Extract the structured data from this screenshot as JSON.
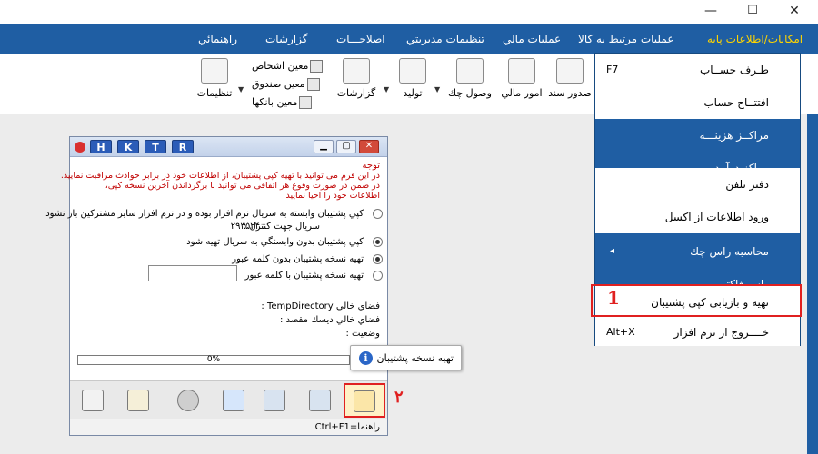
{
  "window": {
    "minimize": "—",
    "maximize": "☐",
    "close": "✕"
  },
  "menu": {
    "items": [
      "امکانات/اطلاعات پایه",
      "عملیات مرتبط به کالا",
      "عملیات مالي",
      "تنظیمات مدیریتي",
      "اصلاحـــات",
      "گزارشات",
      "راهنمائي"
    ]
  },
  "toolbar": {
    "buttons": [
      "صدور سند",
      "امور مالي",
      "وصول چك",
      "تولید",
      "گزارشات",
      "تنظیمات"
    ],
    "small_items": [
      "معین اشخاص",
      "معین صندوق",
      "معین بانکها"
    ]
  },
  "dropdown": {
    "items": [
      {
        "label": "طـرف حســاب",
        "shortcut": "F7"
      },
      {
        "label": "افتتــاح حساب",
        "shortcut": ""
      },
      {
        "label": "مراکــز هزینـــه",
        "shortcut": ""
      },
      {
        "label": "مراکز درآمد",
        "shortcut": ""
      },
      {
        "label": "دفتر تلفن",
        "shortcut": ""
      },
      {
        "label": "ورود اطلاعات از اکسل",
        "shortcut": ""
      },
      {
        "label": "محاسبه راس چك",
        "shortcut": "◂"
      },
      {
        "label": "راس فاکتــور",
        "shortcut": ""
      },
      {
        "label": "تهیه و بازیابی کپی پشتیبان",
        "shortcut": ""
      },
      {
        "label": "خــــروج از نرم افزار",
        "shortcut": "Alt+X"
      }
    ],
    "step_number": "1"
  },
  "dialog": {
    "hktr": [
      "H",
      "K",
      "T",
      "R"
    ],
    "warning_title": "توجه",
    "warning_lines": [
      "در این فرم می توانید با تهیه کپی پشتیبان، از اطلاعات خود در برابر حوادث مراقبت نمایید.",
      "در ضمن در صورت وقوع هر اتفاقی می توانید با برگرداندن آخرین نسخه کپی،",
      "اطلاعات خود را احیا نمایید"
    ],
    "option_serial": "کپي پشتیبان وابسته به سریال نرم افزار بوده و در نرم افزار سایر مشترکین باز نشود",
    "serial_label": "سریال جهت کنترل :",
    "serial_value": "۲۹۳۵۲۴",
    "option_no_serial": "کپي پشتیبان بدون وابستگي به سریال تهیه شود",
    "option_no_password": "تهیه نسخه پشتیبان بدون کلمه عبور",
    "option_password": "تهیه نسخه پشتیبان با کلمه عبور",
    "free_temp": "فضاي خالي TempDirectory :",
    "free_dest": "فضاي خالي دیسك مقصد :",
    "status_label": "وضعیت :",
    "progress": "0%",
    "progress_fraction": 0,
    "bottom_status": "راهنما=Ctrl+F1",
    "step_number": "۲"
  },
  "tooltip": {
    "text": "تهیه نسخه پشتیبان"
  }
}
